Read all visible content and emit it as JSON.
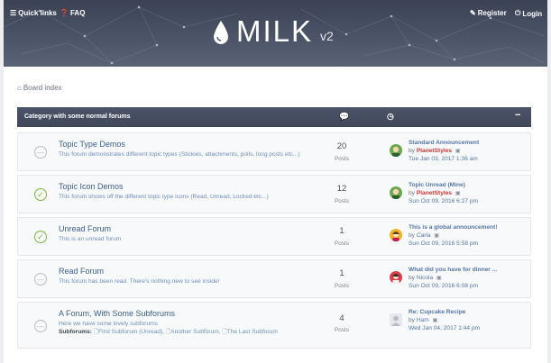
{
  "header": {
    "quick_links": "Quick links",
    "faq": "FAQ",
    "register": "Register",
    "login": "Login",
    "logo_text": "MILK",
    "logo_version": "v2"
  },
  "breadcrumb": {
    "label": "Board index"
  },
  "category": {
    "title": "Category with some normal forums"
  },
  "forums": [
    {
      "title": "Topic Type Demos",
      "description": "This forum demonstrates different topic types (Stickies, attachments, polls, long posts etc...)",
      "count": "20",
      "count_label": "Posts",
      "last_title": "Standard Announcement",
      "by": "by",
      "last_author": "PlanetStyles",
      "last_time": "Tue Jan 03, 2017 1:36 am"
    },
    {
      "title": "Topic Icon Demos",
      "description": "This forum shows off the different topic type icons (Read, Unread, Locked etc...)",
      "count": "12",
      "count_label": "Posts",
      "last_title": "Topic Unread (Mine)",
      "by": "by",
      "last_author": "PlanetStyles",
      "last_time": "Sun Oct 09, 2016 6:27 pm"
    },
    {
      "title": "Unread Forum",
      "description": "This is an unread forum",
      "count": "1",
      "count_label": "Posts",
      "last_title": "This is a global announcement!",
      "by": "by",
      "last_author": "Carla",
      "last_time": "Sun Oct 09, 2016 5:58 pm"
    },
    {
      "title": "Read Forum",
      "description": "This forum has been read. There's nothing new to see inside!",
      "count": "1",
      "count_label": "Posts",
      "last_title": "What did you have for dinner ...",
      "by": "by",
      "last_author": "Nicola",
      "last_time": "Sun Oct 09, 2016 6:08 pm"
    },
    {
      "title": "A Forum, With Some Subforums",
      "description": "Here we have some lovely subforums",
      "subforums_label": "Subforums:",
      "subforums": [
        "First Subforum (Unread)",
        "Another Subforum",
        "The Last Subforum"
      ],
      "count": "4",
      "count_label": "Posts",
      "last_title": "Re: Cupcake Recipe",
      "by": "by",
      "last_author": "Ham",
      "last_time": "Wed Jan 04, 2017 1:44 pm"
    }
  ],
  "colors": {
    "header_bg": "#454d60",
    "unread_green": "#7aba3a",
    "link_blue": "#3b5e8f",
    "author_red": "#d43636"
  }
}
